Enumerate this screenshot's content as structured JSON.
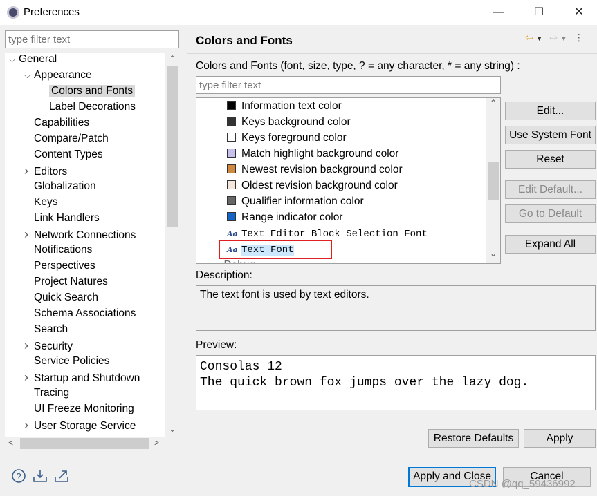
{
  "window": {
    "title": "Preferences"
  },
  "left": {
    "filter_placeholder": "type filter text",
    "tree": [
      {
        "label": "General",
        "depth": 0,
        "arrow": "expanded"
      },
      {
        "label": "Appearance",
        "depth": 1,
        "arrow": "expanded"
      },
      {
        "label": "Colors and Fonts",
        "depth": 2,
        "arrow": "none",
        "selected": true
      },
      {
        "label": "Label Decorations",
        "depth": 2,
        "arrow": "none"
      },
      {
        "label": "Capabilities",
        "depth": 1,
        "arrow": "none"
      },
      {
        "label": "Compare/Patch",
        "depth": 1,
        "arrow": "none"
      },
      {
        "label": "Content Types",
        "depth": 1,
        "arrow": "none"
      },
      {
        "label": "Editors",
        "depth": 1,
        "arrow": "collapsed"
      },
      {
        "label": "Globalization",
        "depth": 1,
        "arrow": "none"
      },
      {
        "label": "Keys",
        "depth": 1,
        "arrow": "none"
      },
      {
        "label": "Link Handlers",
        "depth": 1,
        "arrow": "none"
      },
      {
        "label": "Network Connections",
        "depth": 1,
        "arrow": "collapsed"
      },
      {
        "label": "Notifications",
        "depth": 1,
        "arrow": "none"
      },
      {
        "label": "Perspectives",
        "depth": 1,
        "arrow": "none"
      },
      {
        "label": "Project Natures",
        "depth": 1,
        "arrow": "none"
      },
      {
        "label": "Quick Search",
        "depth": 1,
        "arrow": "none"
      },
      {
        "label": "Schema Associations",
        "depth": 1,
        "arrow": "none"
      },
      {
        "label": "Search",
        "depth": 1,
        "arrow": "none"
      },
      {
        "label": "Security",
        "depth": 1,
        "arrow": "collapsed"
      },
      {
        "label": "Service Policies",
        "depth": 1,
        "arrow": "none"
      },
      {
        "label": "Startup and Shutdown",
        "depth": 1,
        "arrow": "collapsed"
      },
      {
        "label": "Tracing",
        "depth": 1,
        "arrow": "none"
      },
      {
        "label": "UI Freeze Monitoring",
        "depth": 1,
        "arrow": "none"
      },
      {
        "label": "User Storage Service",
        "depth": 1,
        "arrow": "collapsed"
      }
    ]
  },
  "right": {
    "title": "Colors and Fonts",
    "description_label": "Colors and Fonts (font, size, type, ? = any character, * = any string) :",
    "filter_placeholder": "type filter text",
    "items": [
      {
        "label": "Information text color",
        "kind": "color",
        "color": "#000000"
      },
      {
        "label": "Keys background color",
        "kind": "color",
        "color": "#333333"
      },
      {
        "label": "Keys foreground color",
        "kind": "color",
        "color": "#ffffff"
      },
      {
        "label": "Match highlight background color",
        "kind": "color",
        "color": "#c8c0ec"
      },
      {
        "label": "Newest revision background color",
        "kind": "color",
        "color": "#d08840"
      },
      {
        "label": "Oldest revision background color",
        "kind": "color",
        "color": "#f5e6dc"
      },
      {
        "label": "Qualifier information color",
        "kind": "color",
        "color": "#666666"
      },
      {
        "label": "Range indicator color",
        "kind": "color",
        "color": "#1464c8"
      },
      {
        "label": "Text Editor Block Selection Font",
        "kind": "font"
      },
      {
        "label": "Text Font",
        "kind": "font",
        "selected": true
      },
      {
        "label": "Debug",
        "kind": "folder"
      }
    ],
    "buttons": {
      "edit": "Edit...",
      "use_system_font": "Use System Font",
      "reset": "Reset",
      "edit_default": "Edit Default...",
      "go_to_default": "Go to Default",
      "expand_all": "Expand All"
    },
    "description": {
      "label": "Description:",
      "text": "The text font is used by text editors."
    },
    "preview": {
      "label": "Preview:",
      "line1": "Consolas 12",
      "line2": "The quick brown fox jumps over the lazy dog."
    },
    "restore_defaults": "Restore Defaults",
    "apply": "Apply"
  },
  "footer": {
    "apply_and_close": "Apply and Close",
    "cancel": "Cancel",
    "watermark": "CSDN @qq_59436992"
  }
}
